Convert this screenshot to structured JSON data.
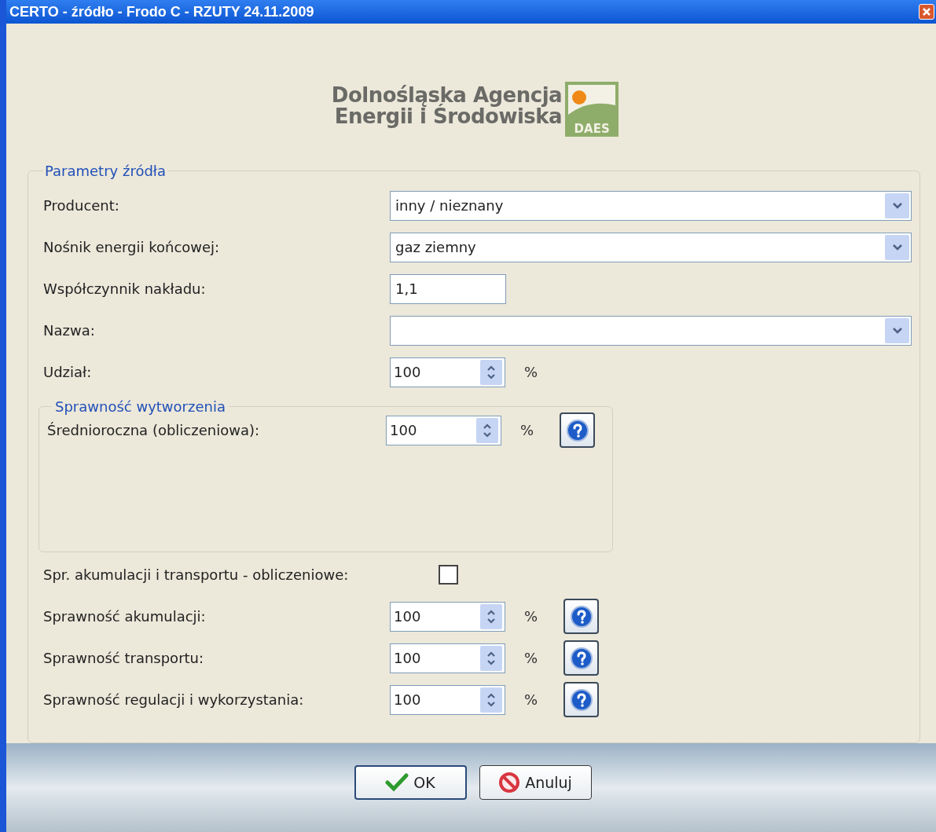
{
  "window": {
    "title": "CERTO - źródło - Frodo C - RZUTY 24.11.2009"
  },
  "logo": {
    "line_1": "Dolnośląska  Agencja",
    "line_2": "Energii  i  Środowiska",
    "badge": "DAES"
  },
  "group": {
    "legend": "Parametry źródła",
    "fields": [
      {
        "kind": "combo",
        "label": "Producent:",
        "value": "inny / nieznany"
      },
      {
        "kind": "combo",
        "label": "Nośnik energii końcowej:",
        "value": "gaz ziemny"
      },
      {
        "kind": "text",
        "label": "Współczynnik nakładu:",
        "value": "1,1"
      },
      {
        "kind": "combo",
        "label": "Nazwa:"
      },
      {
        "kind": "spinner",
        "label": "Udział:",
        "value": "100",
        "unit": "%",
        "help": false
      }
    ],
    "subgroup": {
      "legend": "Sprawność wytworzenia",
      "fields": [
        {
          "kind": "spinner",
          "label": "Średnioroczna (obliczeniowa):",
          "value": "100",
          "unit": "%",
          "help": true
        }
      ]
    },
    "fields_after": [
      {
        "kind": "checkbox",
        "label": "Spr. akumulacji i transportu - obliczeniowe:",
        "checked": false
      },
      {
        "kind": "spinner",
        "label": "Sprawność akumulacji:",
        "value": "100",
        "unit": "%",
        "help": true
      },
      {
        "kind": "spinner",
        "label": "Sprawność transportu:",
        "value": "100",
        "unit": "%",
        "help": true
      },
      {
        "kind": "spinner",
        "label": "Sprawność regulacji i wykorzystania:",
        "value": "100",
        "unit": "%",
        "help": true
      }
    ]
  },
  "buttons": [
    {
      "kind": "ok",
      "label": "OK"
    },
    {
      "kind": "cancel",
      "label": "Anuluj"
    }
  ]
}
